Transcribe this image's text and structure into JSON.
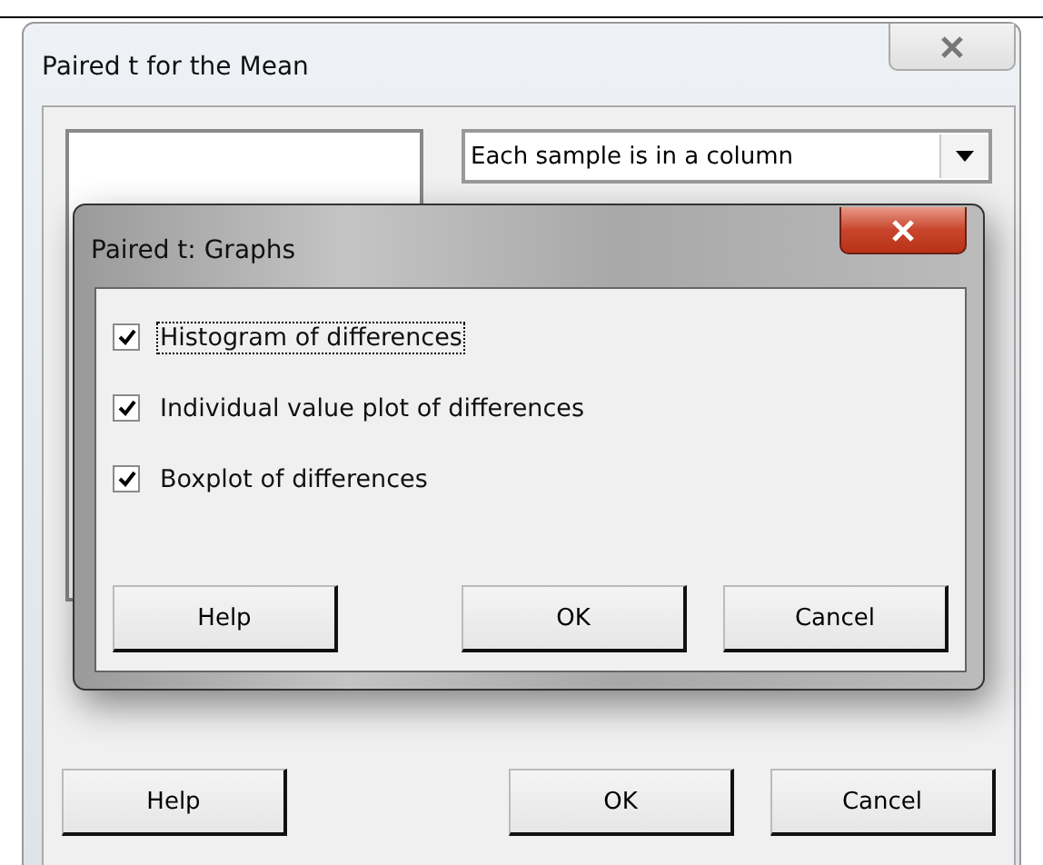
{
  "main_dialog": {
    "title": "Paired t for the Mean",
    "dropdown": {
      "value": "Each sample is in a column"
    },
    "buttons": [
      "Help",
      "OK",
      "Cancel"
    ]
  },
  "graphs_dialog": {
    "title": "Paired t: Graphs",
    "options": [
      {
        "label": "Histogram of differences",
        "checked": true,
        "focused": true
      },
      {
        "label": "Individual value plot of differences",
        "checked": true,
        "focused": false
      },
      {
        "label": "Boxplot of differences",
        "checked": true,
        "focused": false
      }
    ],
    "buttons": [
      "Help",
      "OK",
      "Cancel"
    ]
  }
}
